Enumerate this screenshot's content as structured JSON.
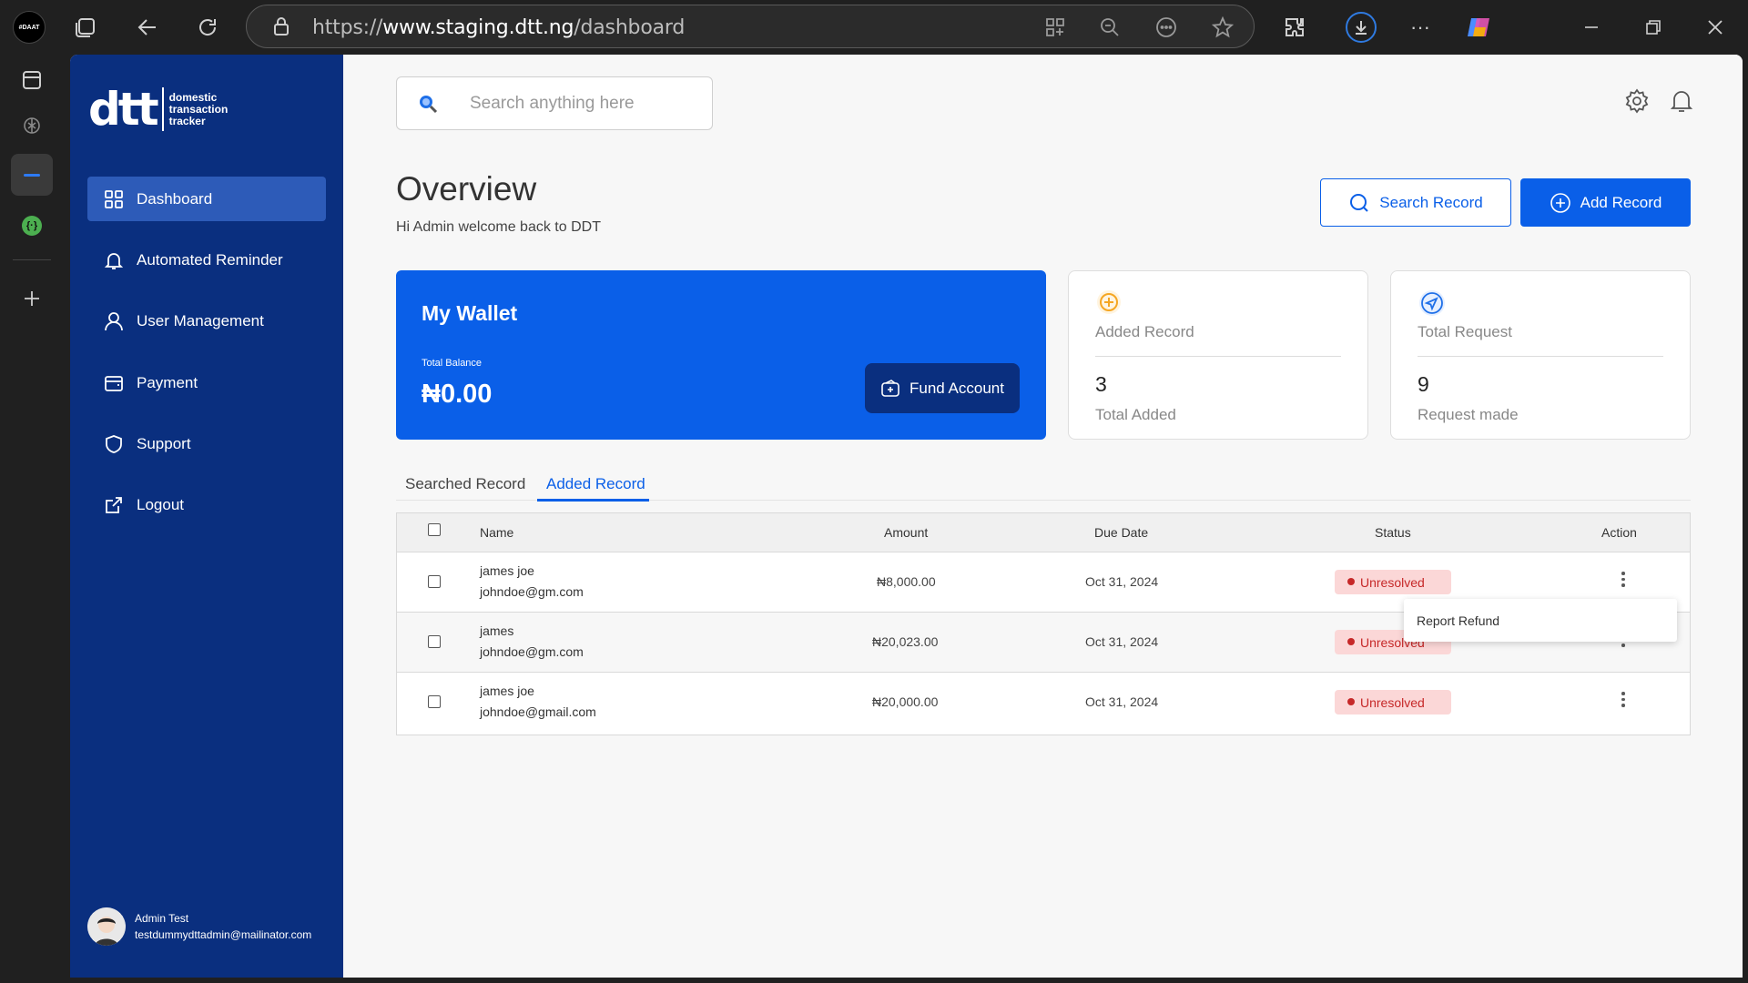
{
  "browser": {
    "url_prefix": "https://",
    "url_host": "www.staging.dtt.ng",
    "url_path": "/dashboard",
    "profile_label": "#DAAT"
  },
  "brand": {
    "logo_text": "dtt",
    "tagline_1": "domestic",
    "tagline_2": "transaction",
    "tagline_3": "tracker"
  },
  "sidebar": {
    "items": [
      {
        "label": "Dashboard",
        "icon": "grid-icon"
      },
      {
        "label": "Automated Reminder",
        "icon": "bell-icon"
      },
      {
        "label": "User Management",
        "icon": "user-icon"
      },
      {
        "label": "Payment",
        "icon": "wallet-icon"
      },
      {
        "label": "Support",
        "icon": "shield-icon"
      },
      {
        "label": "Logout",
        "icon": "external-link-icon"
      }
    ],
    "user": {
      "name": "Admin Test",
      "email": "testdummydttadmin@mailinator.com"
    }
  },
  "header": {
    "search_placeholder": "Search anything here"
  },
  "overview": {
    "title": "Overview",
    "subtitle": "Hi Admin welcome back to DDT",
    "search_record_label": "Search Record",
    "add_record_label": "Add Record"
  },
  "wallet": {
    "title": "My Wallet",
    "balance_label": "Total Balance",
    "balance": "₦0.00",
    "fund_label": "Fund Account"
  },
  "cards": [
    {
      "label": "Added Record",
      "value": "3",
      "sub": "Total Added"
    },
    {
      "label": "Total Request",
      "value": "9",
      "sub": "Request made"
    }
  ],
  "tabs": [
    "Searched Record",
    "Added Record"
  ],
  "table": {
    "headers": [
      "Name",
      "Amount",
      "Due Date",
      "Status",
      "Action"
    ],
    "rows": [
      {
        "name": "james joe",
        "email": "johndoe@gm.com",
        "amount": "₦8,000.00",
        "due": "Oct 31, 2024",
        "status": "Unresolved"
      },
      {
        "name": "james",
        "email": "johndoe@gm.com",
        "amount": "₦20,023.00",
        "due": "Oct 31, 2024",
        "status": "Unresolved"
      },
      {
        "name": "james joe",
        "email": "johndoe@gmail.com",
        "amount": "₦20,000.00",
        "due": "Oct 31, 2024",
        "status": "Unresolved"
      }
    ]
  },
  "popup": {
    "label": "Report Refund"
  },
  "colors": {
    "primary": "#0a5fe8",
    "sidebar": "#0a2f7f",
    "danger": "#c62828"
  }
}
